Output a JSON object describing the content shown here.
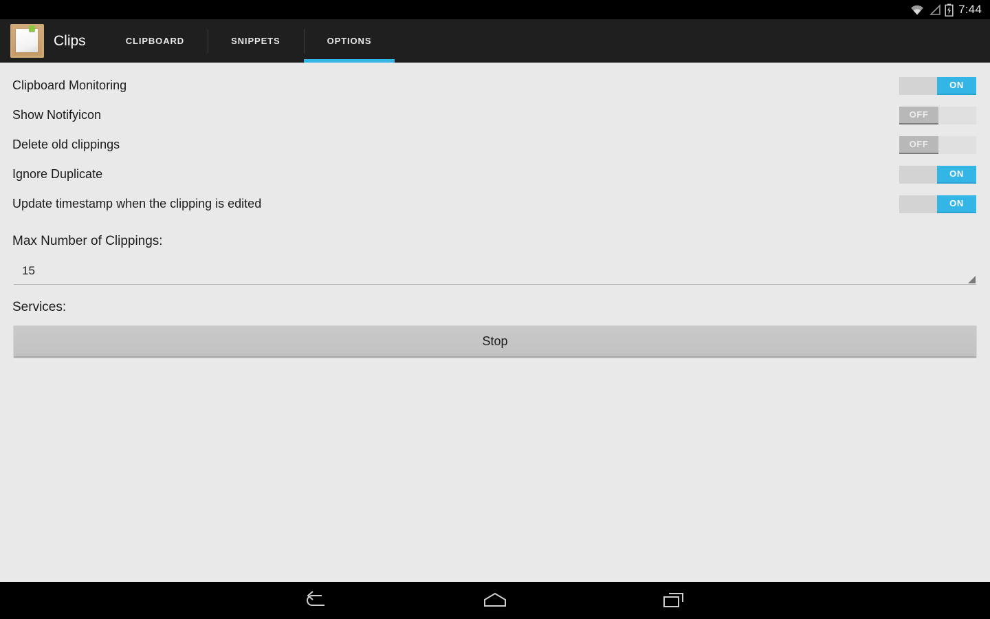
{
  "status_bar": {
    "time": "7:44",
    "icons": [
      "wifi-icon",
      "signal-icon",
      "battery-charging-icon"
    ]
  },
  "action_bar": {
    "app_icon": "clipboard-icon",
    "title": "Clips",
    "tabs": [
      {
        "label": "CLIPBOARD",
        "active": false
      },
      {
        "label": "SNIPPETS",
        "active": false
      },
      {
        "label": "OPTIONS",
        "active": true
      }
    ]
  },
  "options": {
    "settings": [
      {
        "label": "Clipboard Monitoring",
        "state": "ON"
      },
      {
        "label": "Show Notifyicon",
        "state": "OFF"
      },
      {
        "label": "Delete old clippings",
        "state": "OFF"
      },
      {
        "label": "Ignore Duplicate",
        "state": "ON"
      },
      {
        "label": "Update timestamp when the clipping is edited",
        "state": "ON"
      }
    ],
    "max_clippings": {
      "heading": "Max Number of Clippings:",
      "value": "15"
    },
    "services": {
      "heading": "Services:",
      "button_label": "Stop"
    }
  },
  "nav_bar": {
    "buttons": [
      "back-icon",
      "home-icon",
      "recents-icon"
    ]
  },
  "colors": {
    "accent": "#33b5e5",
    "action_bar_bg": "#1f1f1f",
    "content_bg": "#e9e9e9",
    "status_bar_bg": "#000000"
  }
}
